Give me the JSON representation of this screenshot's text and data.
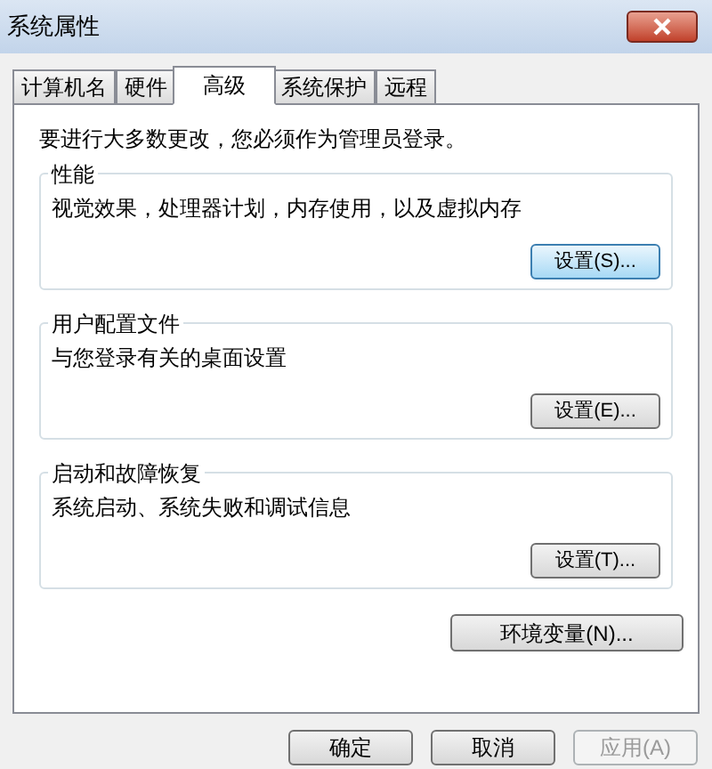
{
  "window": {
    "title": "系统属性"
  },
  "tabs": [
    {
      "label": "计算机名",
      "selected": false
    },
    {
      "label": "硬件",
      "selected": false
    },
    {
      "label": "高级",
      "selected": true
    },
    {
      "label": "系统保护",
      "selected": false
    },
    {
      "label": "远程",
      "selected": false
    }
  ],
  "notice": "要进行大多数更改，您必须作为管理员登录。",
  "groups": [
    {
      "title": "性能",
      "description": "视觉效果，处理器计划，内存使用，以及虚拟内存",
      "button": {
        "label": "设置(S)...",
        "focused": true
      }
    },
    {
      "title": "用户配置文件",
      "description": "与您登录有关的桌面设置",
      "button": {
        "label": "设置(E)...",
        "focused": false
      }
    },
    {
      "title": "启动和故障恢复",
      "description": "系统启动、系统失败和调试信息",
      "button": {
        "label": "设置(T)...",
        "focused": false
      }
    }
  ],
  "env_button": "环境变量(N)...",
  "buttons": [
    {
      "label": "确定",
      "disabled": false
    },
    {
      "label": "取消",
      "disabled": false
    },
    {
      "label": "应用(A)",
      "disabled": true
    }
  ]
}
